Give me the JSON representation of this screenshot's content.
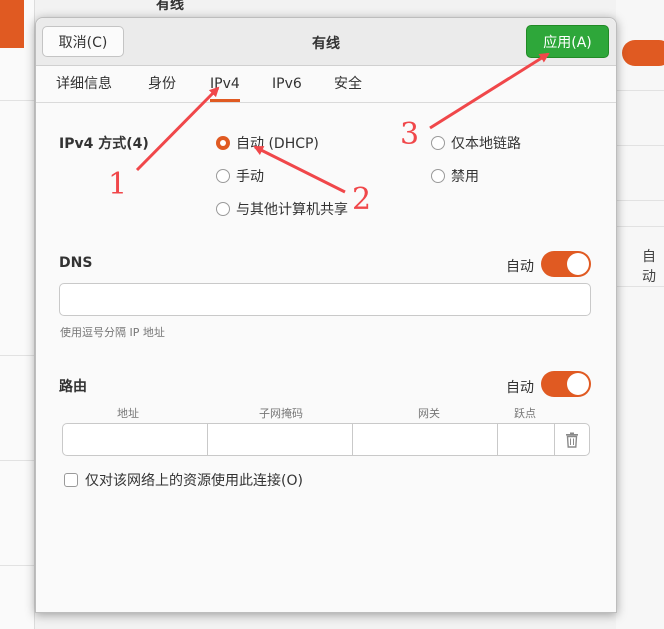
{
  "background": {
    "title": "有线",
    "auto_label": "自动"
  },
  "dialog": {
    "title": "有线",
    "cancel_label": "取消(C)",
    "apply_label": "应用(A)"
  },
  "tabs": [
    {
      "label": "详细信息"
    },
    {
      "label": "身份"
    },
    {
      "label": "IPv4",
      "active": true
    },
    {
      "label": "IPv6"
    },
    {
      "label": "安全"
    }
  ],
  "ipv4": {
    "method_label": "IPv4 方式(4)",
    "options": [
      {
        "label": "自动 (DHCP)",
        "checked": true
      },
      {
        "label": "手动",
        "checked": false
      },
      {
        "label": "与其他计算机共享",
        "checked": false
      },
      {
        "label": "仅本地链路",
        "checked": false
      },
      {
        "label": "禁用",
        "checked": false
      }
    ]
  },
  "dns": {
    "label": "DNS",
    "auto_label": "自动",
    "auto_on": true,
    "value": "",
    "hint": "使用逗号分隔 IP 地址"
  },
  "routes": {
    "label": "路由",
    "auto_label": "自动",
    "auto_on": true,
    "columns": [
      "地址",
      "子网掩码",
      "网关",
      "跃点"
    ]
  },
  "checkbox": {
    "label": "仅对该网络上的资源使用此连接(O)",
    "checked": false
  },
  "annotations": [
    "1",
    "2",
    "3"
  ],
  "colors": {
    "accent": "#e05a22",
    "apply_green": "#2ea73a",
    "annotation_red": "#f0474a"
  }
}
